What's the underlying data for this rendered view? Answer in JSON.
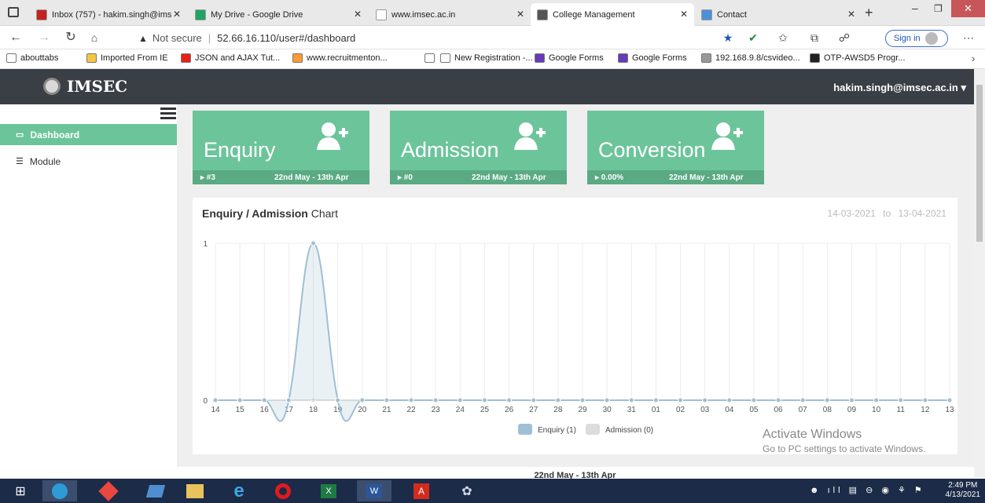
{
  "browser": {
    "tabs": [
      {
        "label": "Inbox (757) - hakim.singh@ims",
        "color": "#c5221f",
        "active": false
      },
      {
        "label": "My Drive - Google Drive",
        "color": "#1fa463",
        "active": false
      },
      {
        "label": "www.imsec.ac.in",
        "color": "#ffffff",
        "active": false
      },
      {
        "label": "College Management",
        "color": "#555555",
        "active": true
      },
      {
        "label": "Contact",
        "color": "#4a90d9",
        "active": false
      }
    ],
    "new_tab": "+",
    "address": {
      "security": "Not secure",
      "url": "52.66.16.110/user#/dashboard"
    },
    "sign_in": "Sign in",
    "bookmarks": [
      {
        "label": "abouttabs",
        "color": "#ffffff"
      },
      {
        "label": "Imported From IE",
        "color": "#f5c542"
      },
      {
        "label": "JSON and AJAX Tut...",
        "color": "#e62117"
      },
      {
        "label": "www.recruitmenton...",
        "color": "#ff9933"
      },
      {
        "label": "",
        "color": "#ffffff"
      },
      {
        "label": "New Registration -...",
        "color": "#ffffff"
      },
      {
        "label": "Google Forms",
        "color": "#673ab7"
      },
      {
        "label": "Google Forms",
        "color": "#673ab7"
      },
      {
        "label": "192.168.9.8/csvideo...",
        "color": "#999999"
      },
      {
        "label": "OTP-AWSD5 Progr...",
        "color": "#222222"
      }
    ]
  },
  "app": {
    "brand": "IMSEC",
    "user": "hakim.singh@imsec.ac.in ▾",
    "sidebar": [
      {
        "label": "Dashboard",
        "icon": "laptop-icon",
        "active": true
      },
      {
        "label": "Module",
        "icon": "list-icon",
        "active": false
      }
    ],
    "cards": [
      {
        "title": "Enquiry",
        "value": "▸ #3",
        "range": "22nd May - 13th Apr"
      },
      {
        "title": "Admission",
        "value": "▸ #0",
        "range": "22nd May - 13th Apr"
      },
      {
        "title": "Conversion",
        "value": "▸ 0.00%",
        "range": "22nd May - 13th Apr"
      }
    ],
    "chart_panel": {
      "title_bold": "Enquiry / Admission",
      "title_rest": " Chart",
      "date_from": "14-03-2021",
      "date_to_label": "to",
      "date_to": "13-04-2021"
    },
    "panel2_title": "22nd May - 13th Apr",
    "accent": "#6cc49a"
  },
  "chart_data": {
    "type": "area",
    "categories": [
      "14",
      "15",
      "16",
      "17",
      "18",
      "19",
      "20",
      "21",
      "22",
      "23",
      "24",
      "25",
      "26",
      "27",
      "28",
      "29",
      "30",
      "31",
      "01",
      "02",
      "03",
      "04",
      "05",
      "06",
      "07",
      "08",
      "09",
      "10",
      "11",
      "12",
      "13"
    ],
    "series": [
      {
        "name": "Enquiry (1)",
        "values": [
          0,
          0,
          0,
          0,
          1,
          0,
          0,
          0,
          0,
          0,
          0,
          0,
          0,
          0,
          0,
          0,
          0,
          0,
          0,
          0,
          0,
          0,
          0,
          0,
          0,
          0,
          0,
          0,
          0,
          0,
          0
        ],
        "color": "#9fbfd4"
      },
      {
        "name": "Admission (0)",
        "values": [
          0,
          0,
          0,
          0,
          0,
          0,
          0,
          0,
          0,
          0,
          0,
          0,
          0,
          0,
          0,
          0,
          0,
          0,
          0,
          0,
          0,
          0,
          0,
          0,
          0,
          0,
          0,
          0,
          0,
          0,
          0
        ],
        "color": "#dcdcdc"
      }
    ],
    "yticks": [
      "0",
      "1"
    ],
    "ylim": [
      0,
      1
    ],
    "grid": true,
    "legend": "bottom"
  },
  "watermark": {
    "line1": "Activate Windows",
    "line2": "Go to PC settings to activate Windows."
  },
  "taskbar": {
    "time": "2:49 PM",
    "date": "4/13/2021"
  }
}
